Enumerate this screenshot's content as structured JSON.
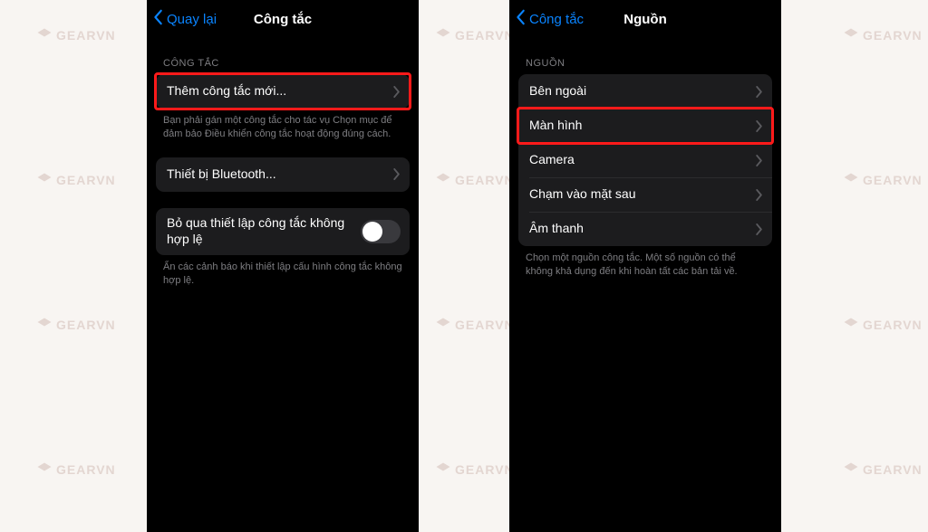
{
  "watermark": "GEARVN",
  "left": {
    "back": "Quay lại",
    "title": "Công tắc",
    "section_header": "CÔNG TẮC",
    "add_switch": "Thêm công tắc mới...",
    "add_note": "Bạn phải gán một công tắc cho tác vụ Chọn mục để đảm bảo Điều khiển công tắc hoạt động đúng cách.",
    "bluetooth": "Thiết bị Bluetooth...",
    "ignore_label": "Bỏ qua thiết lập công tắc không hợp lệ",
    "ignore_note": "Ẩn các cảnh báo khi thiết lập cấu hình công tắc không hợp lệ."
  },
  "right": {
    "back": "Công tắc",
    "title": "Nguồn",
    "section_header": "NGUỒN",
    "items": {
      "0": "Bên ngoài",
      "1": "Màn hình",
      "2": "Camera",
      "3": "Chạm vào mặt sau",
      "4": "Âm thanh"
    },
    "note": "Chọn một nguồn công tắc. Một số nguồn có thể không khả dụng đến khi hoàn tất các bản tải về."
  }
}
